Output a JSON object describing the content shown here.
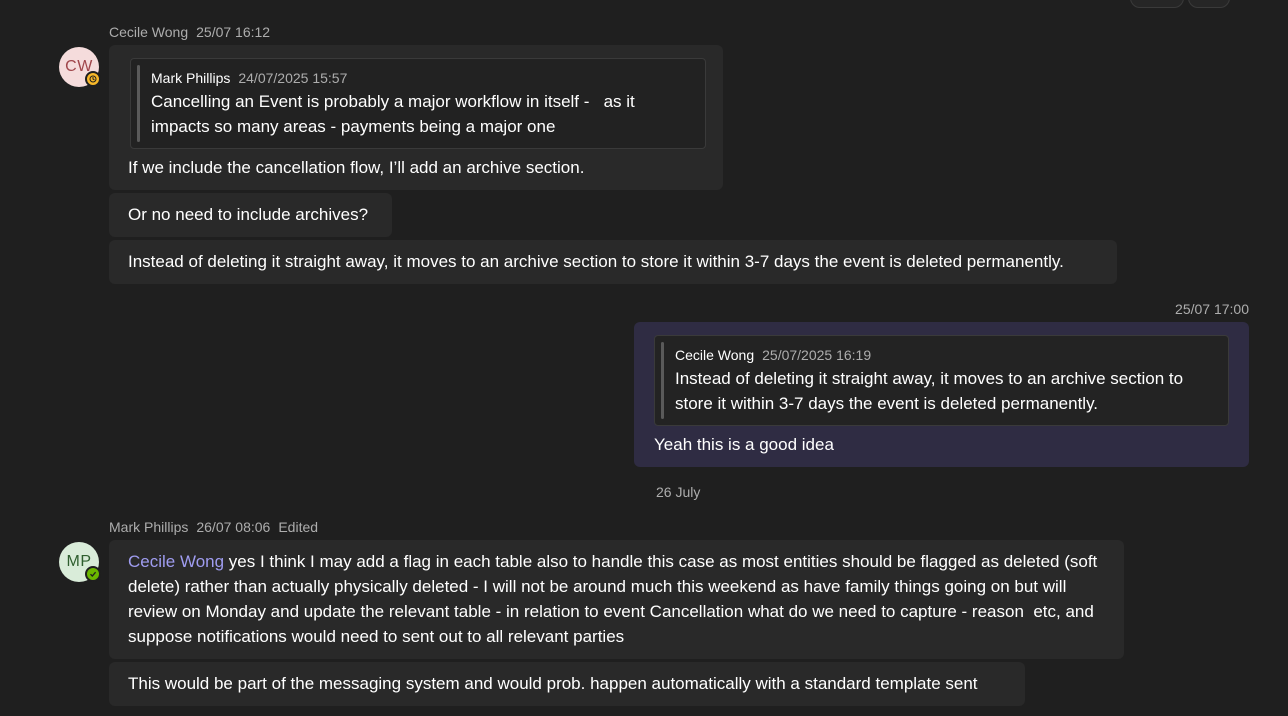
{
  "messages": {
    "cecile_group": {
      "author": "Cecile Wong",
      "time": "25/07 16:12",
      "avatar_initials": "CW",
      "status": "away",
      "quote": {
        "author": "Mark Phillips",
        "time": "24/07/2025 15:57",
        "text": "Cancelling an Event is probably a major workflow in itself -   as it impacts so many areas - payments being a major one"
      },
      "reply_text": "If we include the cancellation flow, I’ll add an archive section.",
      "msg2": "Or no need to include archives?",
      "msg3": "Instead of deleting it straight away, it moves to an archive section to store it within 3-7 days the event is deleted permanently."
    },
    "self_reply": {
      "time": "25/07 17:00",
      "quote": {
        "author": "Cecile Wong",
        "time": "25/07/2025 16:19",
        "text": "Instead of deleting it straight away, it moves to an archive section to store it within 3-7 days the event is deleted permanently."
      },
      "text": "Yeah this is a good idea"
    },
    "date_divider": "26 July",
    "mark_group": {
      "author": "Mark Phillips",
      "time": "26/07 08:06",
      "edited": "Edited",
      "avatar_initials": "MP",
      "status": "available",
      "mention": "Cecile Wong",
      "text": " yes I think I may add a flag in each table also to handle this case as most entities should be flagged as deleted (soft delete) rather than actually physically deleted - I will not be around much this weekend as have family things going on but will review on Monday and update the relevant table - in relation to event Cancellation what do we need to capture - reason  etc, and suppose notifications would need to sent out to all relevant parties",
      "msg2": "This would be part of the messaging system and would prob. happen automatically with a standard template sent"
    }
  },
  "colors": {
    "background": "#1f1f1f",
    "bubble": "#292929",
    "own_bubble": "#2f2c43",
    "mention": "#9f9cf0",
    "away": "#f8b829",
    "available": "#6bb700"
  }
}
